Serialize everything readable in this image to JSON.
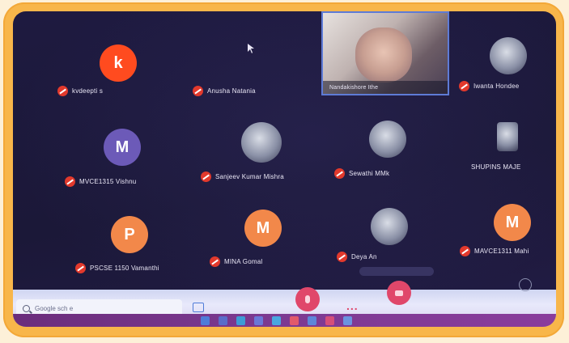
{
  "participants": [
    {
      "initial": "k",
      "avatar_color": "#ff4b1f",
      "name": "kvdeepti s"
    },
    {
      "initial": "",
      "avatar_color": "",
      "name": "Anusha Natania"
    },
    {
      "initial": "",
      "avatar_color": "",
      "name": "Nandakishore Ithe"
    },
    {
      "initial": "",
      "avatar_color": "",
      "name": "Iwanta Hondee"
    },
    {
      "initial": "M",
      "avatar_color": "#6c5ab8",
      "name": "MVCE1315 Vishnu"
    },
    {
      "initial": "",
      "avatar_color": "",
      "name": "Sanjeev Kumar Mishra"
    },
    {
      "initial": "",
      "avatar_color": "",
      "name": "Sewathi MMk"
    },
    {
      "initial": "",
      "avatar_color": "",
      "name": "SHUPINS MAJE"
    },
    {
      "initial": "P",
      "avatar_color": "#f2884a",
      "name": "PSCSE 1150 Vamanthi"
    },
    {
      "initial": "M",
      "avatar_color": "#f2884a",
      "name": "MINA Gomal"
    },
    {
      "initial": "",
      "avatar_color": "",
      "name": "Deya An"
    },
    {
      "initial": "M",
      "avatar_color": "#f2884a",
      "name": "MAVCE1311 Mahi"
    }
  ],
  "taskbar": {
    "search_placeholder": "Google sch e"
  },
  "controls": {
    "more": "..."
  },
  "colors": {
    "frame": "#f8b64a",
    "background": "#1e1a40",
    "muted": "#e2392c",
    "taskbar": "#7d3a92"
  }
}
